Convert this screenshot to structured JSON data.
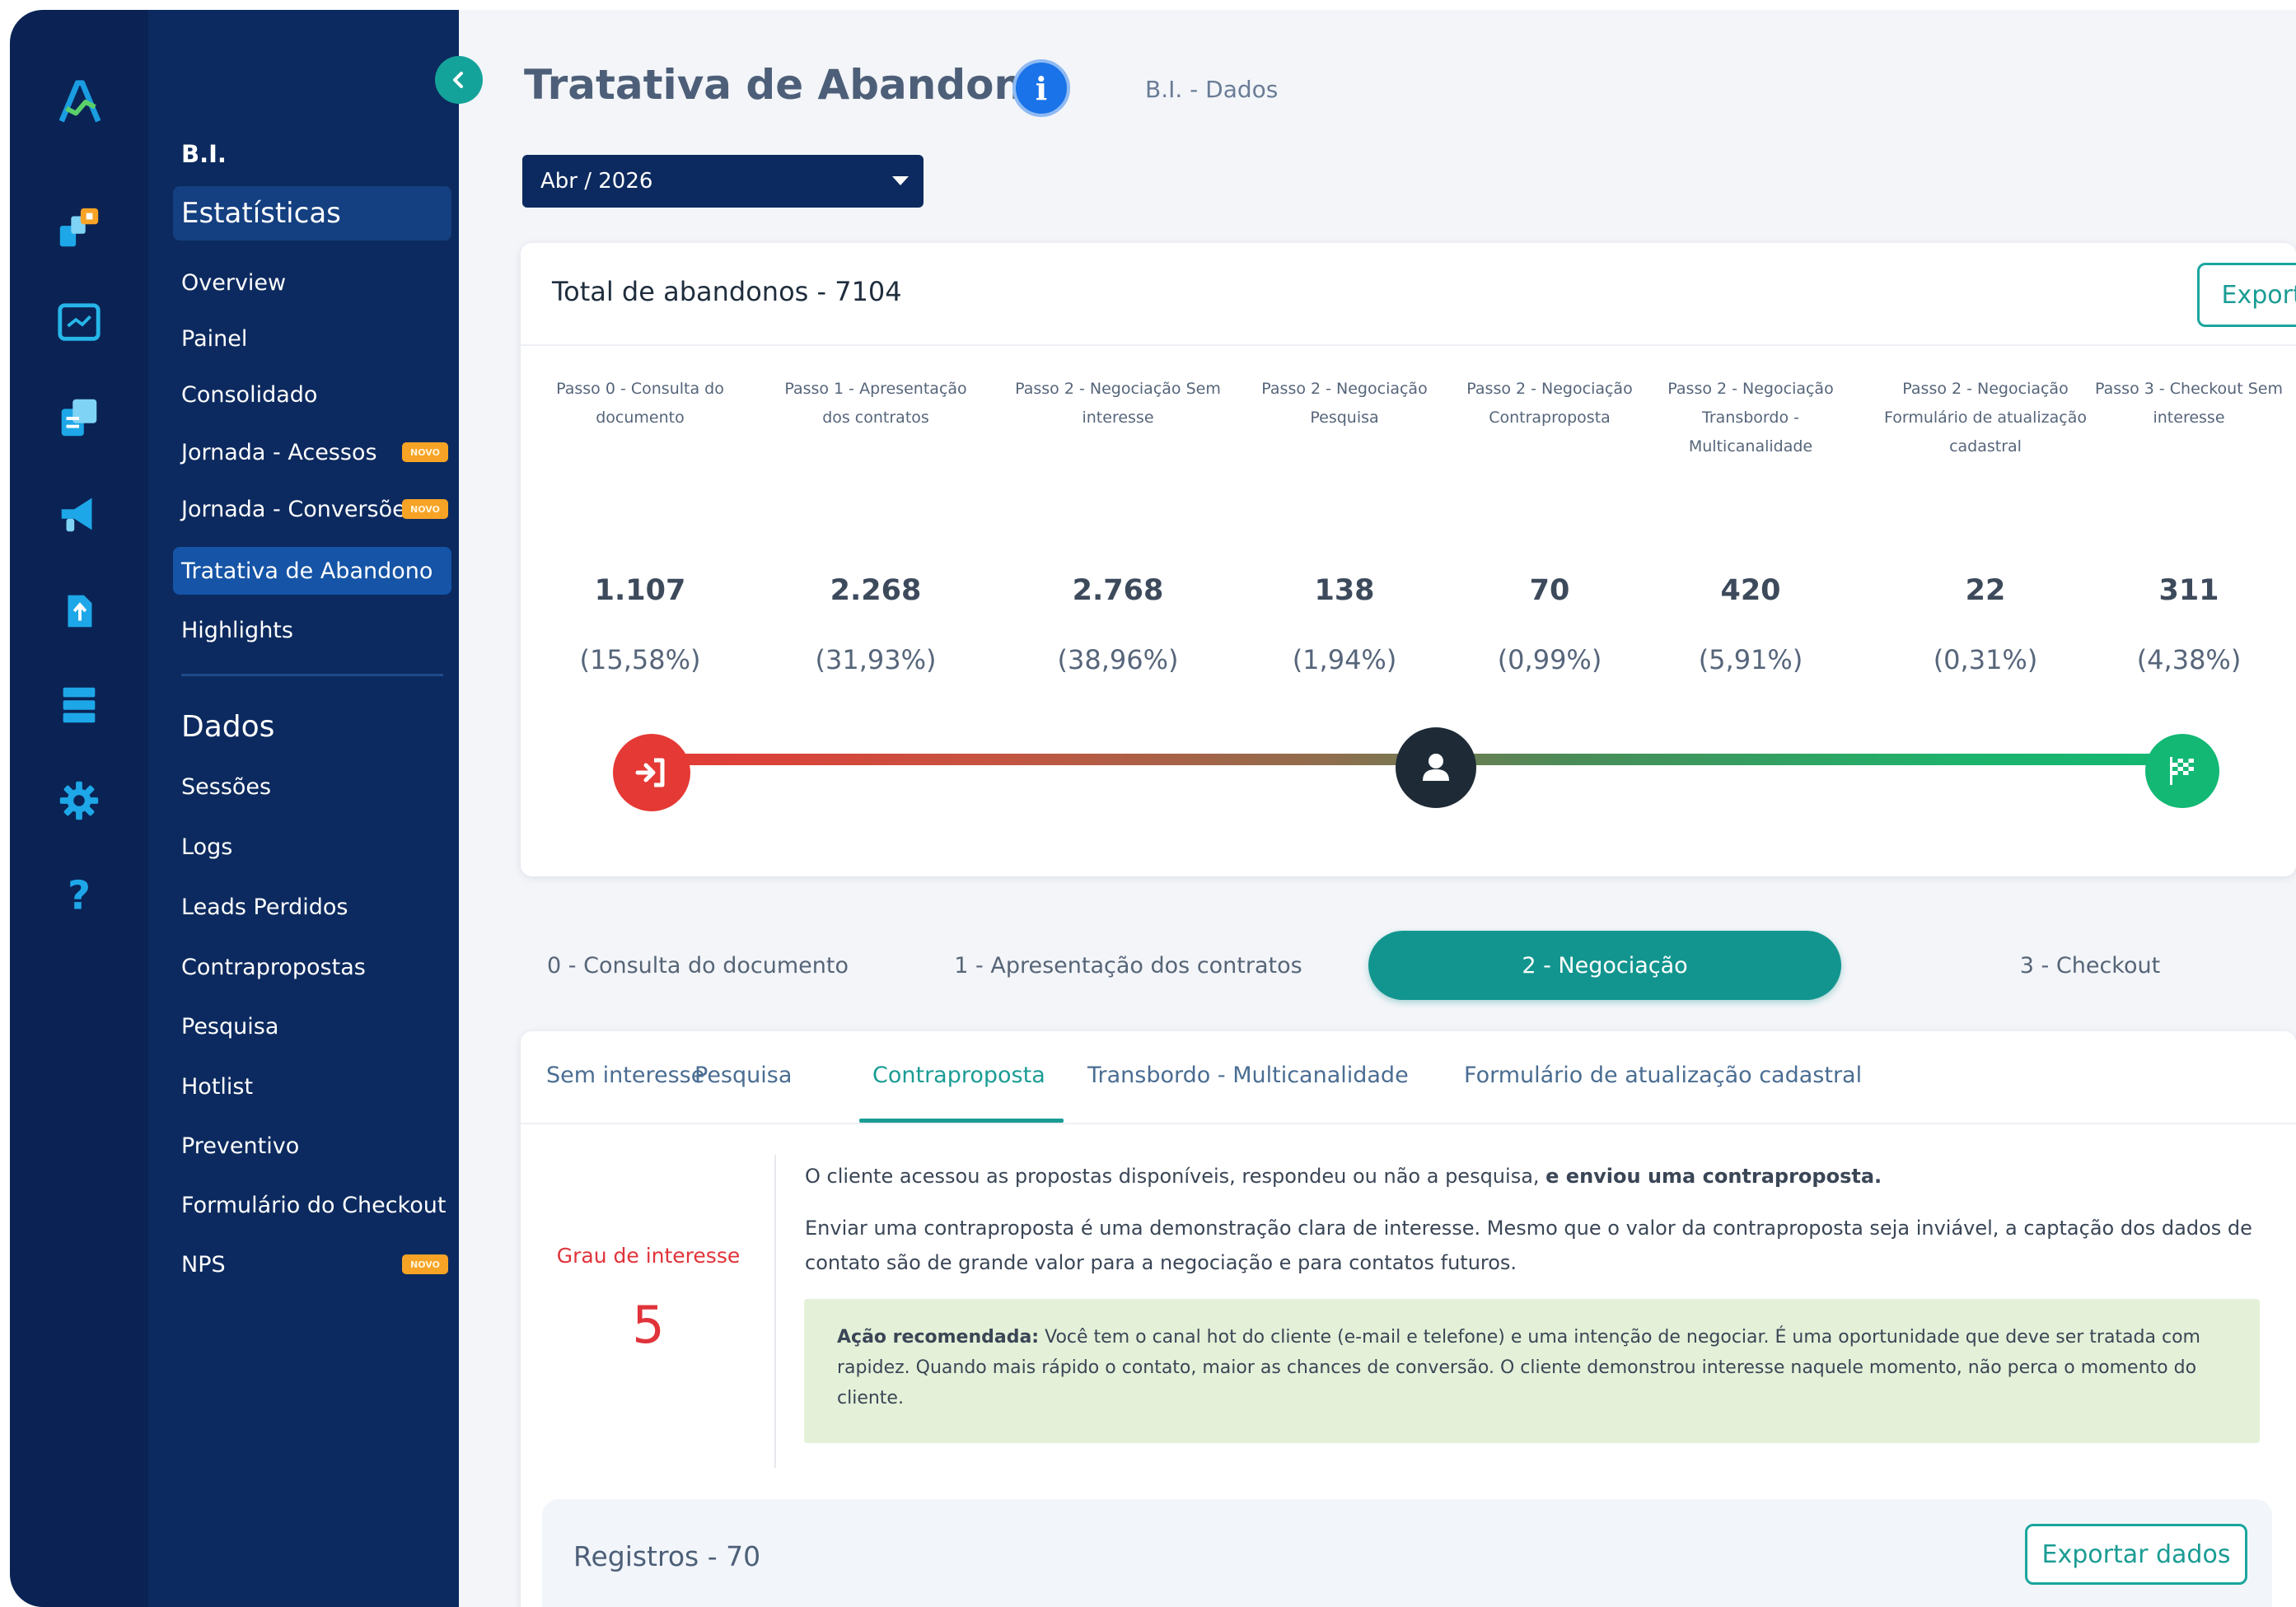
{
  "header": {
    "title": "Tratativa de Abandono",
    "breadcrumb": "B.I. - Dados"
  },
  "filter": {
    "period": "Abr / 2026"
  },
  "menu": {
    "section_bi": "B.I.",
    "section_stats": "Estatísticas",
    "stats_items": [
      {
        "label": "Overview"
      },
      {
        "label": "Painel"
      },
      {
        "label": "Consolidado"
      },
      {
        "label": "Jornada - Acessos",
        "badge": "NOVO"
      },
      {
        "label": "Jornada - Conversões",
        "badge": "NOVO"
      },
      {
        "label": "Tratativa de Abandono"
      },
      {
        "label": "Highlights"
      }
    ],
    "section_dados": "Dados",
    "dados_items": [
      {
        "label": "Sessões"
      },
      {
        "label": "Logs"
      },
      {
        "label": "Leads Perdidos"
      },
      {
        "label": "Contrapropostas"
      },
      {
        "label": "Pesquisa"
      },
      {
        "label": "Hotlist"
      },
      {
        "label": "Preventivo"
      },
      {
        "label": "Formulário do Checkout"
      },
      {
        "label": "NPS",
        "badge": "NOVO"
      }
    ]
  },
  "summary": {
    "title": "Total de abandonos - 7104",
    "export_label": "Exportar dados",
    "steps": [
      {
        "heading": "Passo 0 - Consulta do documento",
        "count": "1.107",
        "pct": "(15,58%)"
      },
      {
        "heading": "Passo 1 - Apresentação dos contratos",
        "count": "2.268",
        "pct": "(31,93%)"
      },
      {
        "heading": "Passo 2 - Negociação Sem interesse",
        "count": "2.768",
        "pct": "(38,96%)"
      },
      {
        "heading": "Passo 2 - Negociação Pesquisa",
        "count": "138",
        "pct": "(1,94%)"
      },
      {
        "heading": "Passo 2 - Negociação Contraproposta",
        "count": "70",
        "pct": "(0,99%)"
      },
      {
        "heading": "Passo 2 - Negociação Transbordo - Multicanalidade",
        "count": "420",
        "pct": "(5,91%)"
      },
      {
        "heading": "Passo 2 - Negociação Formulário de atualização cadastral",
        "count": "22",
        "pct": "(0,31%)"
      },
      {
        "heading": "Passo 3 - Checkout Sem interesse",
        "count": "311",
        "pct": "(4,38%)"
      }
    ]
  },
  "step_tabs": [
    {
      "label": "0 - Consulta do documento"
    },
    {
      "label": "1 - Apresentação dos contratos"
    },
    {
      "label": "2 - Negociação",
      "active": true
    },
    {
      "label": "3 - Checkout"
    }
  ],
  "sub_tabs": [
    {
      "label": "Sem interesse"
    },
    {
      "label": "Pesquisa"
    },
    {
      "label": "Contraproposta",
      "active": true
    },
    {
      "label": "Transbordo - Multicanalidade"
    },
    {
      "label": "Formulário de atualização cadastral"
    }
  ],
  "detail": {
    "interest_label": "Grau de interesse",
    "interest_value": "5",
    "desc1_normal": "O cliente acessou as propostas disponíveis, respondeu ou não a pesquisa, ",
    "desc1_bold": "e enviou uma contraproposta.",
    "desc2": "Enviar uma contraproposta é uma demonstração clara de interesse. Mesmo que o valor da contraproposta seja inviável, a captação dos dados de contato são de grande valor para a negociação e para contatos futuros.",
    "rec_label": "Ação recomendada:",
    "rec_text": " Você tem o canal hot do cliente (e-mail e telefone) e uma intenção de negociar. É uma oportunidade que deve ser tratada com rapidez. Quando mais rápido o contato, maior as chances de conversão. O cliente demonstrou interesse naquele momento, não perca o momento do cliente."
  },
  "records": {
    "title": "Registros - 70",
    "export_label": "Exportar dados"
  },
  "colors": {
    "navy": "#0c2a5f",
    "rail": "#0a2354",
    "teal": "#13958f",
    "red": "#e53935",
    "green": "#12b874",
    "info_blue": "#1a73e8"
  },
  "icons": {
    "rail": [
      "app-logo",
      "chart-cubes-icon",
      "dashboard-icon",
      "documents-icon",
      "megaphone-icon",
      "upload-file-icon",
      "database-icon",
      "gear-icon",
      "help-icon"
    ],
    "progress": [
      "sign-in-icon",
      "user-icon",
      "finish-flag-icon"
    ]
  }
}
